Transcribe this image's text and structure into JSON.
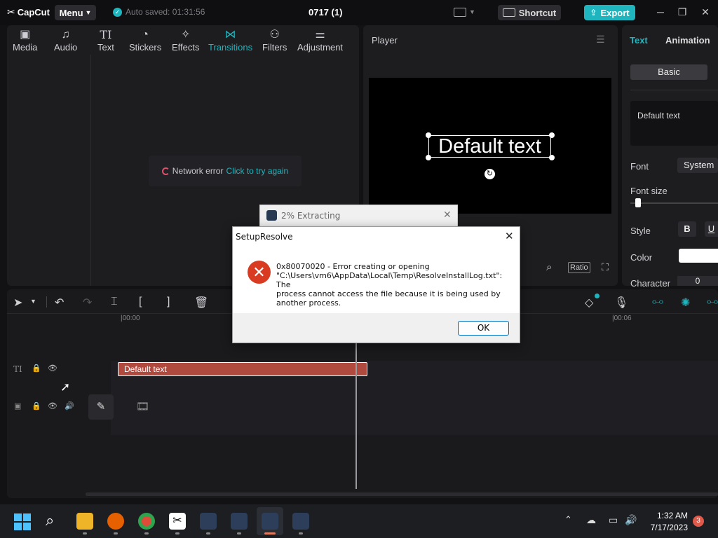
{
  "app": {
    "logo": "CapCut",
    "menu_label": "Menu",
    "autosave": "Auto saved: 01:31:56",
    "project_title": "0717 (1)",
    "shortcut_label": "Shortcut",
    "export_label": "Export"
  },
  "toolbar": {
    "items": [
      {
        "label": "Media",
        "icon": "media-icon"
      },
      {
        "label": "Audio",
        "icon": "audio-icon"
      },
      {
        "label": "Text",
        "icon": "text-icon"
      },
      {
        "label": "Stickers",
        "icon": "stickers-icon"
      },
      {
        "label": "Effects",
        "icon": "effects-icon"
      },
      {
        "label": "Transitions",
        "icon": "transitions-icon",
        "active": true
      },
      {
        "label": "Filters",
        "icon": "filters-icon"
      },
      {
        "label": "Adjustment",
        "icon": "adjustment-icon"
      }
    ]
  },
  "media": {
    "network_error": "Network error",
    "retry_link": "Click to try again"
  },
  "player": {
    "title": "Player",
    "canvas_text": "Default text",
    "ratio_label": "Ratio"
  },
  "inspector": {
    "tab_text": "Text",
    "tab_animation": "Animation",
    "subtab_basic": "Basic",
    "text_value": "Default text",
    "font_label": "Font",
    "font_value": "System",
    "font_size_label": "Font size",
    "style_label": "Style",
    "style_bold": "B",
    "style_underline": "U",
    "color_label": "Color",
    "character_label": "Character",
    "character_value": "0"
  },
  "timeline": {
    "time_start": "|00:00",
    "time_end": "|00:06",
    "text_clip_label": "Default text"
  },
  "extract_window": {
    "title": "2% Extracting"
  },
  "dialog": {
    "title": "SetupResolve",
    "message_line1": "0x80070020 - Error creating or opening",
    "message_line2": "\"C:\\Users\\vm6\\AppData\\Local\\Temp\\ResolveInstallLog.txt\": The",
    "message_line3": "process cannot access the file because it is being used by",
    "message_line4": "another process.",
    "ok_label": "OK"
  },
  "taskbar": {
    "time": "1:32 AM",
    "date": "7/17/2023",
    "notification_count": "3"
  },
  "colors": {
    "accent": "#1fb5be",
    "clip": "#b14a3e",
    "error": "#d83b22"
  }
}
